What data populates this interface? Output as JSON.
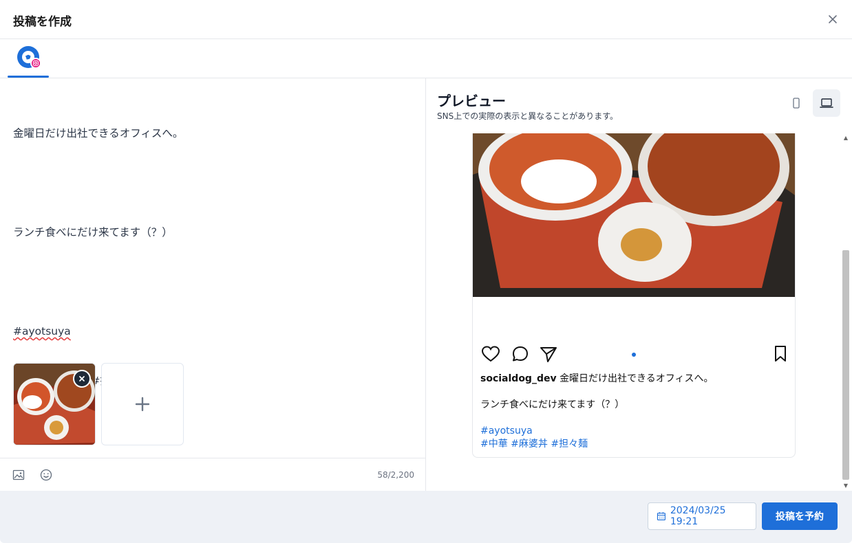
{
  "header": {
    "title": "投稿を作成",
    "close_icon": "close-icon"
  },
  "account_tabs": [
    {
      "network": "instagram",
      "icon": "instagram-icon",
      "active": true
    }
  ],
  "editor": {
    "lines": [
      "金曜日だけ出社できるオフィスへ。",
      "",
      "ランチ食べにだけ来てます（？）",
      "",
      "#ayotsuya",
      "#中華 #麻婆丼 #担々麺"
    ],
    "char_count": "58/2,200",
    "tools": [
      "image-icon",
      "emoji-icon"
    ]
  },
  "preview": {
    "title": "プレビュー",
    "subtitle": "SNS上での実際の表示と異なることがあります。",
    "devices": [
      "mobile",
      "desktop"
    ],
    "selected_device": "desktop",
    "instagram": {
      "username": "socialdog_dev",
      "caption_first": "金曜日だけ出社できるオフィスへ。",
      "caption_second": "ランチ食べにだけ来てます（？）",
      "hashtag_line1": "#ayotsuya",
      "hashtag_line2": "#中華 #麻婆丼 #担々麺"
    }
  },
  "footer": {
    "schedule_datetime": "2024/03/25 19:21",
    "submit_label": "投稿を予約"
  },
  "colors": {
    "accent": "#1e6fd9",
    "instagram_badge": "#e4157e",
    "footer_bg": "#eef1f6"
  }
}
